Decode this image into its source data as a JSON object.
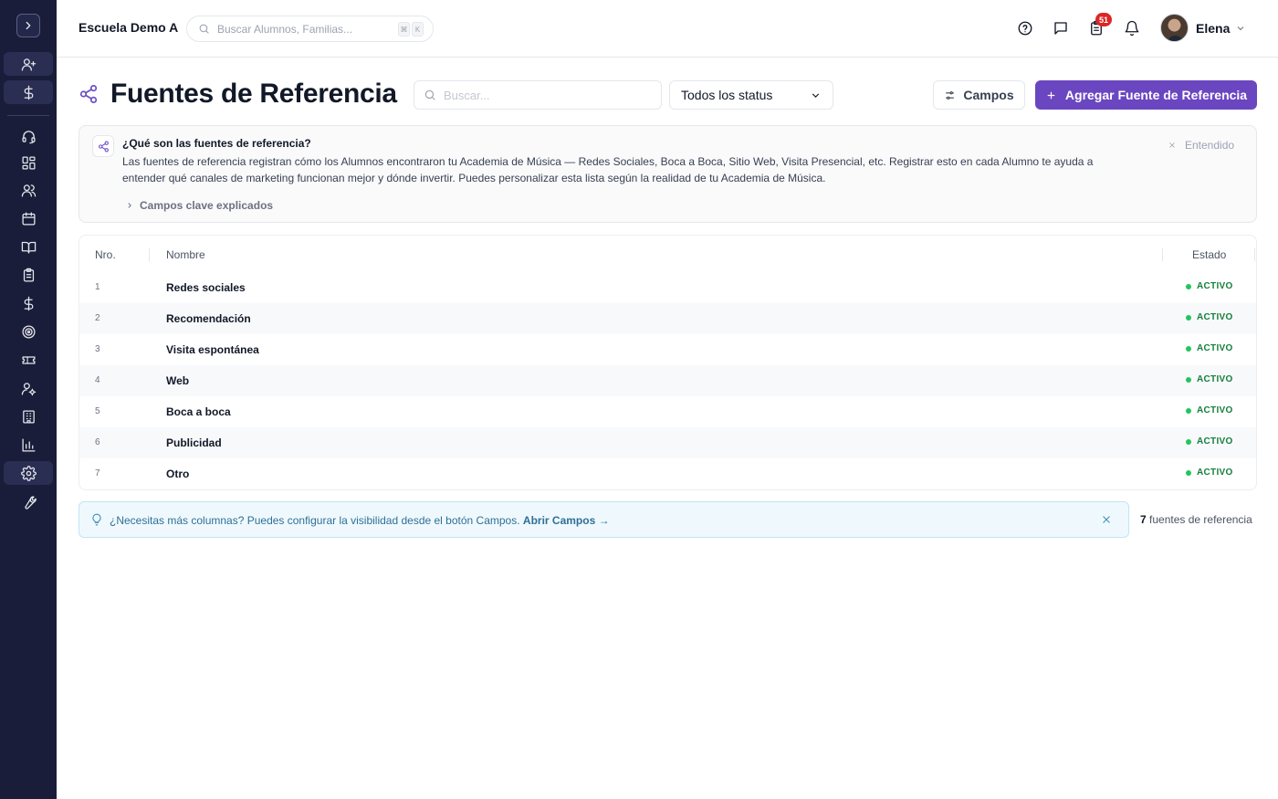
{
  "header": {
    "school_name": "Escuela Demo A",
    "search_placeholder": "Buscar Alumnos, Familias...",
    "shortcut_keys": [
      "⌘",
      "K"
    ],
    "notifications_badge": "51",
    "user_name": "Elena"
  },
  "sidebar": {
    "items": [
      {
        "icon": "add-user-icon",
        "highlighted": true
      },
      {
        "icon": "dollar-icon",
        "highlighted": true
      },
      {
        "icon": "headset-icon"
      },
      {
        "icon": "dashboard-icon"
      },
      {
        "icon": "users-icon"
      },
      {
        "icon": "calendar-icon"
      },
      {
        "icon": "book-icon"
      },
      {
        "icon": "clipboard-icon"
      },
      {
        "icon": "dollar-icon"
      },
      {
        "icon": "target-icon"
      },
      {
        "icon": "ticket-icon"
      },
      {
        "icon": "user-settings-icon"
      },
      {
        "icon": "building-icon"
      },
      {
        "icon": "chart-icon"
      },
      {
        "icon": "gear-icon",
        "highlighted": true
      },
      {
        "icon": "wrench-icon"
      }
    ]
  },
  "page": {
    "title": "Fuentes de Referencia",
    "search_placeholder": "Buscar...",
    "status_filter": "Todos los status",
    "fields_button": "Campos",
    "add_button": "Agregar Fuente de Referencia",
    "accent_color": "#6b46c1"
  },
  "info": {
    "title": "¿Qué son las fuentes de referencia?",
    "text": "Las fuentes de referencia registran cómo los Alumnos encontraron tu Academia de Música — Redes Sociales, Boca a Boca, Sitio Web, Visita Presencial, etc. Registrar esto en cada Alumno te ayuda a entender qué canales de marketing funcionan mejor y dónde invertir. Puedes personalizar esta lista según la realidad de tu Academia de Música.",
    "expander": "Campos clave explicados",
    "dismiss": "Entendido"
  },
  "table": {
    "columns": {
      "num": "Nro.",
      "name": "Nombre",
      "status": "Estado"
    },
    "rows": [
      {
        "num": "1",
        "name": "Redes sociales",
        "status": "ACTIVO"
      },
      {
        "num": "2",
        "name": "Recomendación",
        "status": "ACTIVO"
      },
      {
        "num": "3",
        "name": "Visita espontánea",
        "status": "ACTIVO"
      },
      {
        "num": "4",
        "name": "Web",
        "status": "ACTIVO"
      },
      {
        "num": "5",
        "name": "Boca a boca",
        "status": "ACTIVO"
      },
      {
        "num": "6",
        "name": "Publicidad",
        "status": "ACTIVO"
      },
      {
        "num": "7",
        "name": "Otro",
        "status": "ACTIVO"
      }
    ]
  },
  "tip": {
    "text": "¿Necesitas más columnas? Puedes configurar la visibilidad desde el botón Campos.",
    "link": "Abrir Campos →"
  },
  "footer": {
    "count": "7",
    "count_label": "fuentes de referencia"
  }
}
